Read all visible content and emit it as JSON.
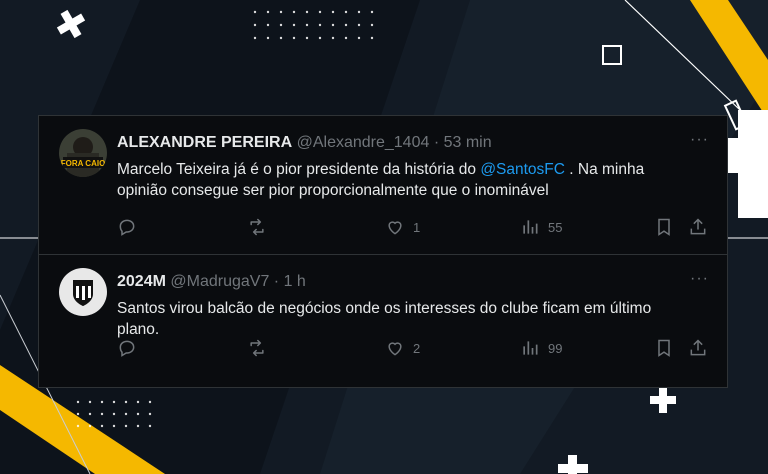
{
  "tweets": [
    {
      "name": "ALEXANDRE PEREIRA",
      "handle": "@Alexandre_1404",
      "separator": "·",
      "time": "53 min",
      "avatar_text": "FORA CAIO",
      "body_before": "Marcelo Teixeira já é o pior presidente da história do ",
      "mention": "@SantosFC",
      "body_after": " . Na minha opinião consegue ser pior proporcionalmente que o inominável",
      "likes": "1",
      "views": "55"
    },
    {
      "name": "2024M",
      "handle": "@MadrugaV7",
      "separator": "·",
      "time": "1 h",
      "body": "Santos virou balcão de negócios onde os interesses do clube ficam em último plano.",
      "likes": "2",
      "views": "99"
    }
  ],
  "more_label": "···",
  "colors": {
    "accent_yellow": "#f5b800",
    "mention_blue": "#1d9bf0",
    "text_primary": "#e7e9ea",
    "text_secondary": "#71767b"
  }
}
